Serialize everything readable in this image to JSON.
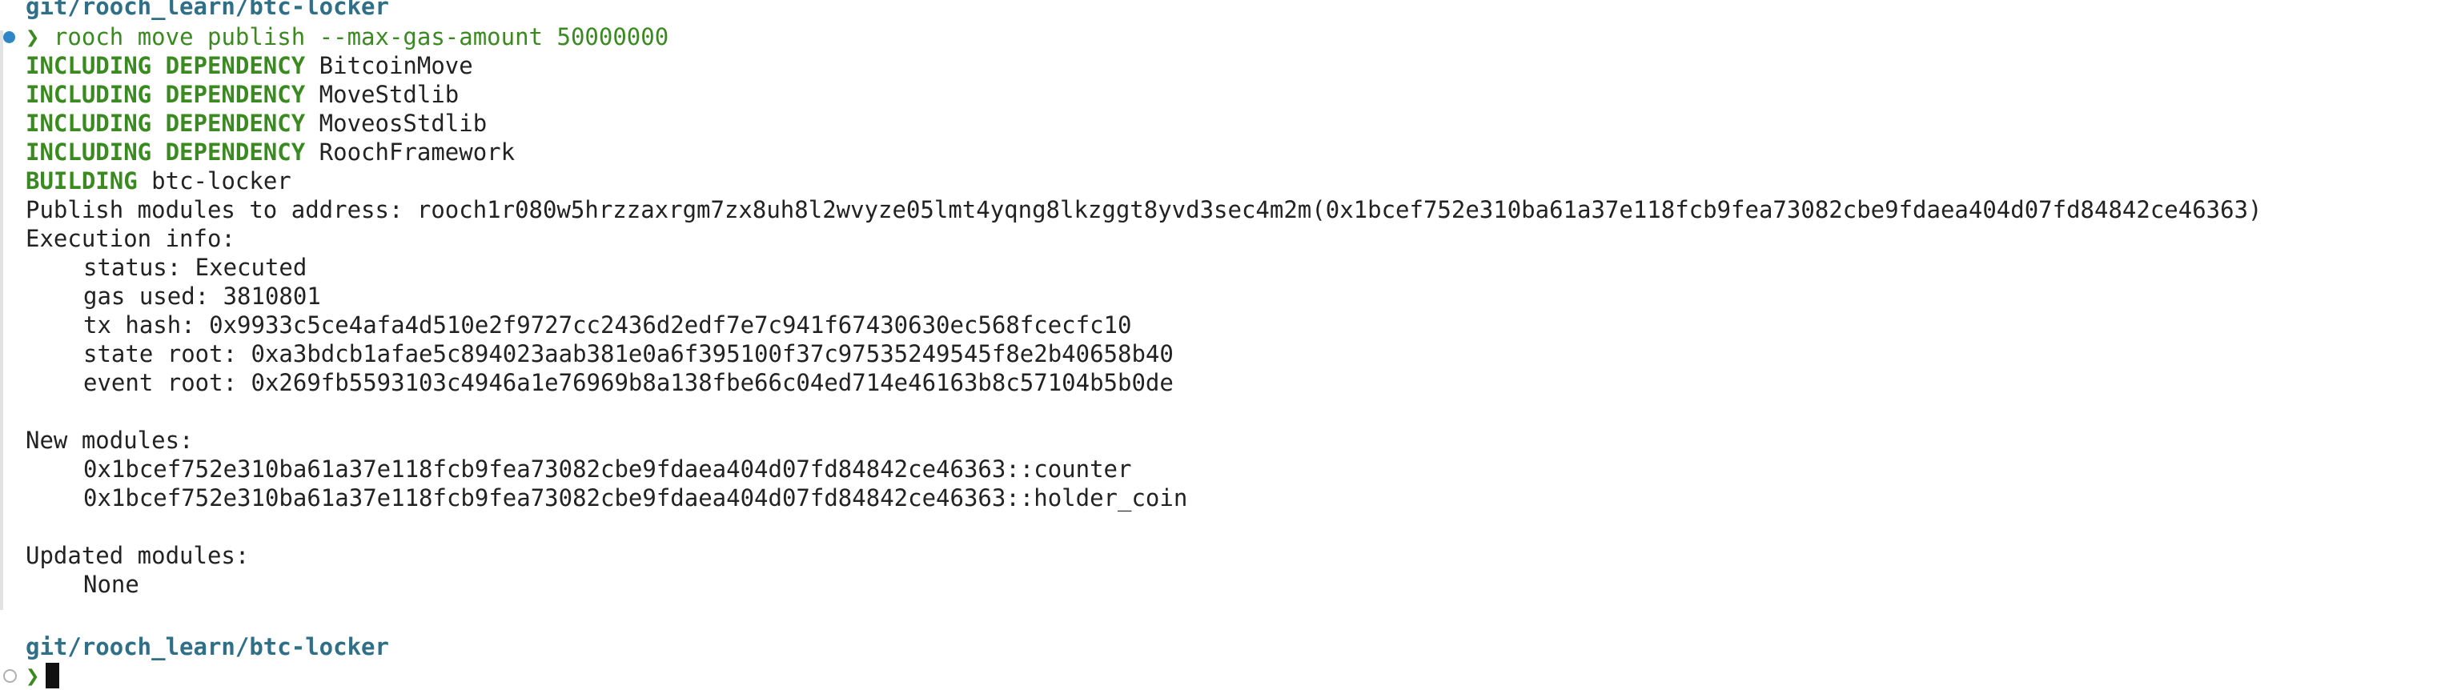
{
  "terminal": {
    "cwd_path": "git/rooch_learn/btc-locker",
    "prompt_symbol": "❯",
    "command": "rooch move publish --max-gas-amount 50000000",
    "dependencies": [
      {
        "tag": "INCLUDING DEPENDENCY",
        "name": "BitcoinMove"
      },
      {
        "tag": "INCLUDING DEPENDENCY",
        "name": "MoveStdlib"
      },
      {
        "tag": "INCLUDING DEPENDENCY",
        "name": "MoveosStdlib"
      },
      {
        "tag": "INCLUDING DEPENDENCY",
        "name": "RoochFramework"
      }
    ],
    "building": {
      "tag": "BUILDING",
      "name": "btc-locker"
    },
    "publish_line": "Publish modules to address: rooch1r080w5hrzzaxrgm7zx8uh8l2wvyze05lmt4yqng8lkzggt8yvd3sec4m2m(0x1bcef752e310ba61a37e118fcb9fea73082cbe9fdaea404d07fd84842ce46363)",
    "execution_info_label": "Execution info:",
    "execution_info": [
      "status: Executed",
      "gas used: 3810801",
      "tx hash: 0x9933c5ce4afa4d510e2f9727cc2436d2edf7e7c941f67430630ec568fcecfc10",
      "state root: 0xa3bdcb1afae5c894023aab381e0a6f395100f37c97535249545f8e2b40658b40",
      "event root: 0x269fb5593103c4946a1e76969b8a138fbe66c04ed714e46163b8c57104b5b0de"
    ],
    "new_modules_label": "New modules:",
    "new_modules": [
      "0x1bcef752e310ba61a37e118fcb9fea73082cbe9fdaea404d07fd84842ce46363::counter",
      "0x1bcef752e310ba61a37e118fcb9fea73082cbe9fdaea404d07fd84842ce46363::holder_coin"
    ],
    "updated_modules_label": "Updated modules:",
    "updated_modules": [
      "None"
    ],
    "colors": {
      "path": "#2f6f87",
      "keyword_green": "#3a8a21",
      "text": "#222222",
      "block_marker_blue": "#2f86c7"
    }
  }
}
